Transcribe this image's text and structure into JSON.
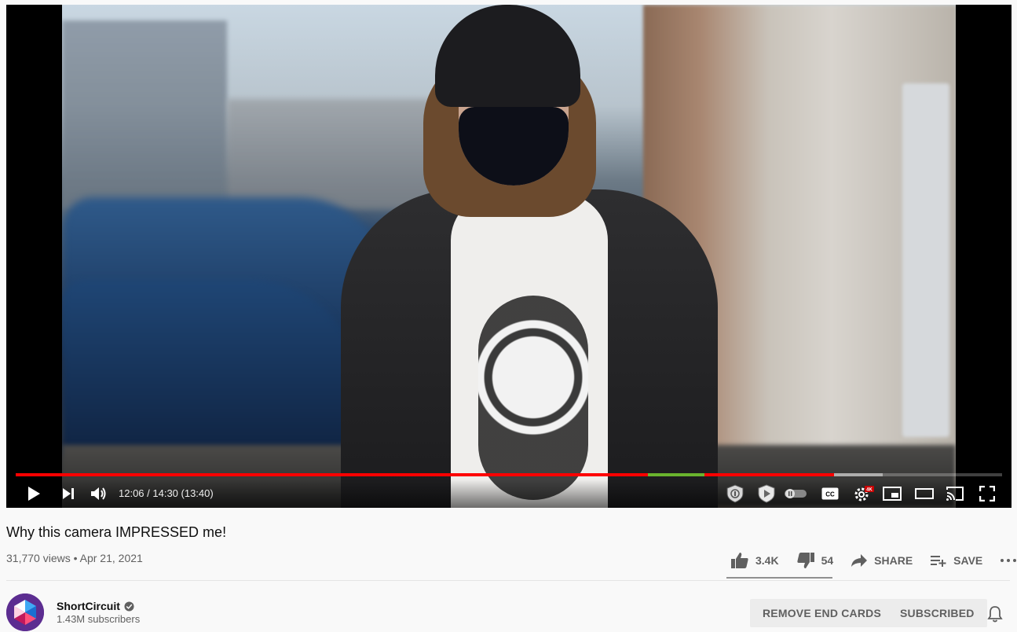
{
  "player": {
    "time_text": "12:06 / 14:30 (13:40)",
    "progress_played_fraction": 0.83,
    "progress_loaded_fraction": 0.879,
    "ad_segment_start_fraction": 0.641,
    "ad_segment_end_fraction": 0.698,
    "accent_color": "#ff0000",
    "controls": [
      "play-icon",
      "next-icon",
      "volume-icon",
      "honey-extension-icon",
      "adblock-shield-icon",
      "autoplay-toggle",
      "captions-icon",
      "settings-icon",
      "miniplayer-icon",
      "theater-mode-icon",
      "cast-icon",
      "fullscreen-icon"
    ],
    "cc_label": "CC",
    "quality_badge": "4K"
  },
  "video": {
    "title": "Why this camera IMPRESSED me!",
    "meta": "31,770 views • Apr 21, 2021",
    "likes": "3.4K",
    "dislikes": "54",
    "share_label": "SHARE",
    "save_label": "SAVE"
  },
  "channel": {
    "name": "ShortCircuit",
    "subscribers": "1.43M subscribers",
    "verified": true
  },
  "buttons": {
    "remove_end_cards": "REMOVE END CARDS",
    "subscribed": "SUBSCRIBED"
  }
}
